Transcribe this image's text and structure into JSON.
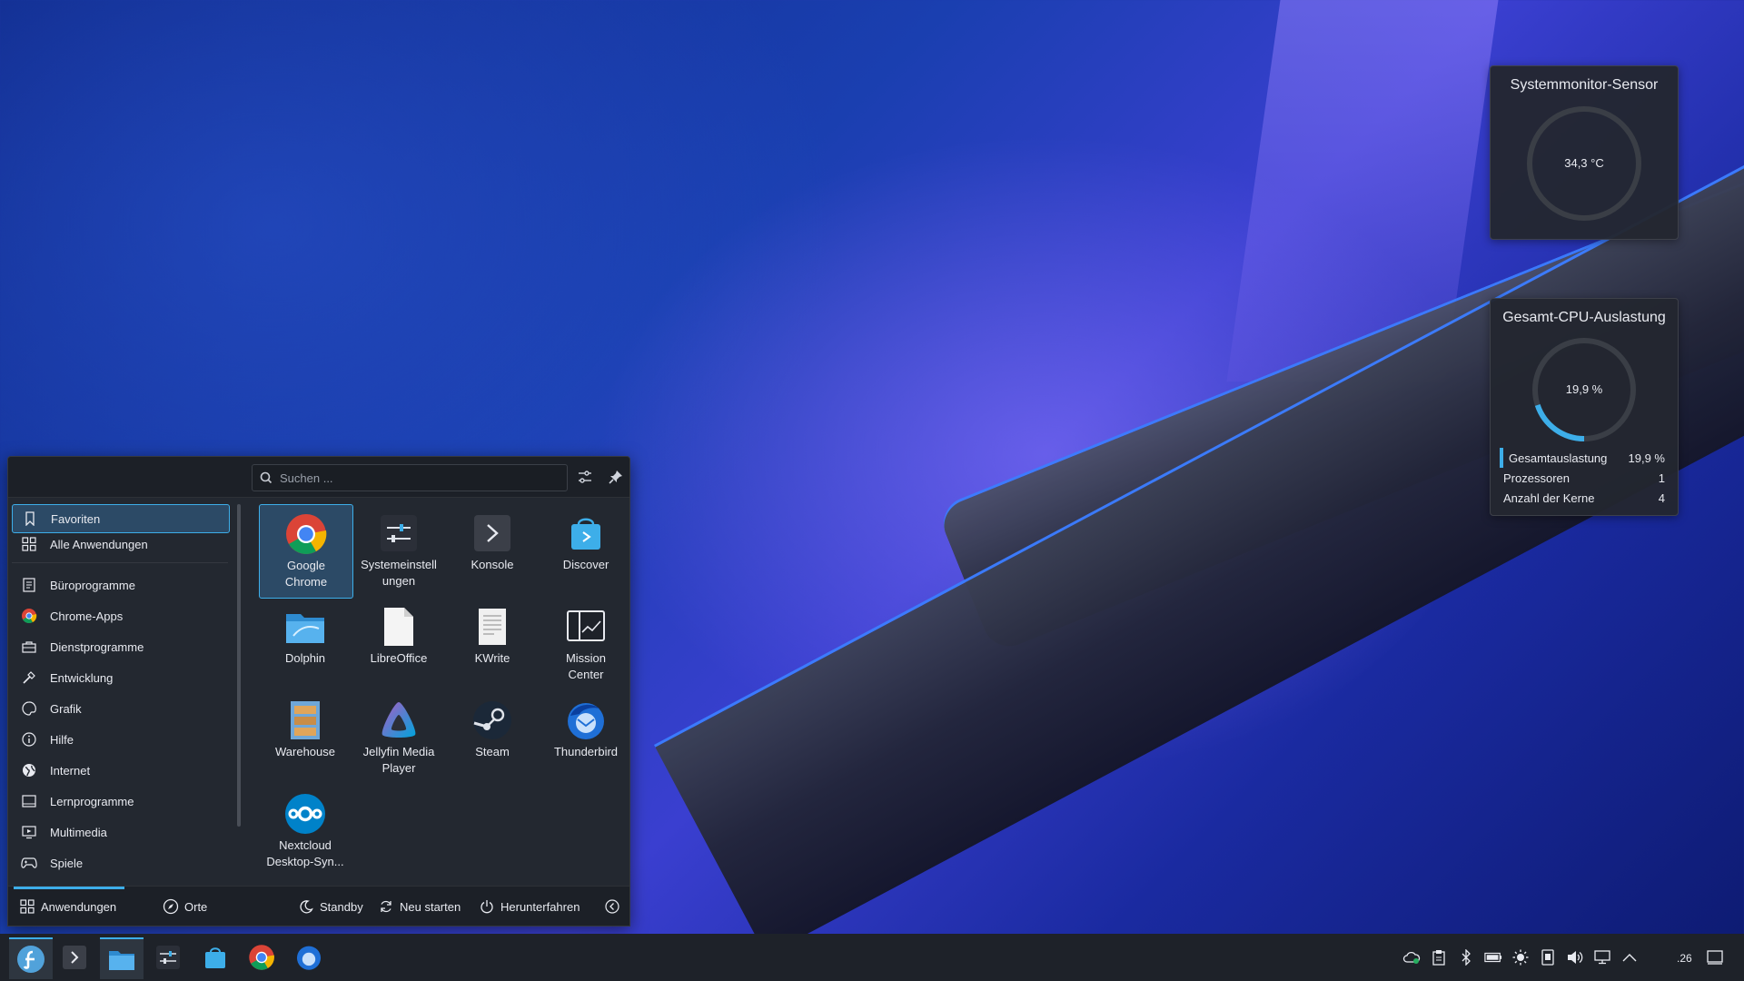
{
  "widgets": {
    "temp": {
      "title": "Systemmonitor-Sensor",
      "value": "34,3 °C",
      "fraction": 0.0
    },
    "cpu": {
      "title": "Gesamt-CPU-Auslastung",
      "value": "19,9 %",
      "fraction": 0.199,
      "rows": [
        {
          "label": "Gesamtauslastung",
          "value": "19,9 %"
        },
        {
          "label": "Prozessoren",
          "value": "1"
        },
        {
          "label": "Anzahl der Kerne",
          "value": "4"
        }
      ],
      "accent": "#3daee9"
    }
  },
  "launcher": {
    "search_placeholder": "Suchen ...",
    "sidebar": [
      {
        "label": "Favoriten",
        "icon": "bookmark-icon",
        "active": true
      },
      {
        "label": "Alle Anwendungen",
        "icon": "grid-icon"
      },
      {
        "label": "Büroprogramme",
        "icon": "office-icon"
      },
      {
        "label": "Chrome-Apps",
        "icon": "chrome-icon"
      },
      {
        "label": "Dienstprogramme",
        "icon": "toolbox-icon"
      },
      {
        "label": "Entwicklung",
        "icon": "hammer-icon"
      },
      {
        "label": "Grafik",
        "icon": "palette-icon"
      },
      {
        "label": "Hilfe",
        "icon": "info-icon"
      },
      {
        "label": "Internet",
        "icon": "globe-icon"
      },
      {
        "label": "Lernprogramme",
        "icon": "education-icon"
      },
      {
        "label": "Multimedia",
        "icon": "monitor-play-icon"
      },
      {
        "label": "Spiele",
        "icon": "gamepad-icon"
      }
    ],
    "apps": [
      {
        "name": "Google\nChrome",
        "l1": "Google",
        "l2": "Chrome",
        "icon": "chrome-icon",
        "selected": true
      },
      {
        "l1": "Systemeinstell",
        "l2": "ungen",
        "icon": "settings-icon"
      },
      {
        "l1": "Konsole",
        "l2": "",
        "icon": "terminal-icon"
      },
      {
        "l1": "Discover",
        "l2": "",
        "icon": "store-icon"
      },
      {
        "l1": "Dolphin",
        "l2": "",
        "icon": "folder-icon"
      },
      {
        "l1": "LibreOffice",
        "l2": "",
        "icon": "document-icon"
      },
      {
        "l1": "KWrite",
        "l2": "",
        "icon": "text-editor-icon"
      },
      {
        "l1": "Mission",
        "l2": "Center",
        "icon": "mission-center-icon"
      },
      {
        "l1": "Warehouse",
        "l2": "",
        "icon": "warehouse-icon"
      },
      {
        "l1": "Jellyfin Media",
        "l2": "Player",
        "icon": "jellyfin-icon"
      },
      {
        "l1": "Steam",
        "l2": "",
        "icon": "steam-icon"
      },
      {
        "l1": "Thunderbird",
        "l2": "",
        "icon": "thunderbird-icon"
      },
      {
        "l1": "Nextcloud",
        "l2": "Desktop-Syn...",
        "icon": "nextcloud-icon"
      }
    ],
    "footer": {
      "applications": "Anwendungen",
      "places": "Orte",
      "standby": "Standby",
      "restart": "Neu starten",
      "shutdown": "Herunterfahren"
    }
  },
  "taskbar": {
    "apps": [
      "fedora-launcher-icon",
      "terminal-icon",
      "folder-icon",
      "settings-icon",
      "store-icon",
      "chrome-icon",
      "thunderbird-icon"
    ],
    "tray": [
      "cloud-sync-icon",
      "clipboard-icon",
      "bluetooth-icon",
      "battery-icon",
      "brightness-icon",
      "device-icon",
      "volume-icon",
      "network-icon",
      "chevron-up-icon"
    ],
    "clock": ".26"
  }
}
